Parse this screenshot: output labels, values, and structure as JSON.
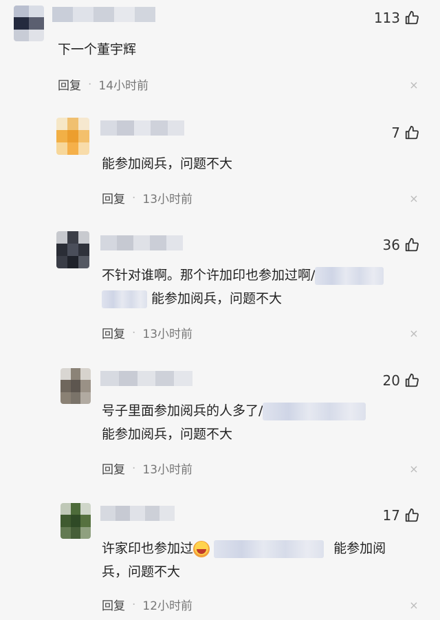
{
  "labels": {
    "reply": "回复",
    "dot": "·",
    "close": "×"
  },
  "comments": [
    {
      "likes": "113",
      "text": "下一个董宇辉",
      "time": "14小时前"
    },
    {
      "likes": "7",
      "text": "能参加阅兵，问题不大",
      "time": "13小时前"
    },
    {
      "likes": "36",
      "text1": "不针对谁啊。那个许加印也参加过啊/",
      "text2": "能参加阅兵，问题不大",
      "time": "13小时前"
    },
    {
      "likes": "20",
      "text1": "号子里面参加阅兵的人多了/",
      "text2": "能参加阅兵，问题不大",
      "time": "13小时前"
    },
    {
      "likes": "17",
      "text1a": "许家印也参加过",
      "text1b": "能参加阅",
      "text2": "兵，问题不大",
      "time": "12小时前"
    }
  ]
}
